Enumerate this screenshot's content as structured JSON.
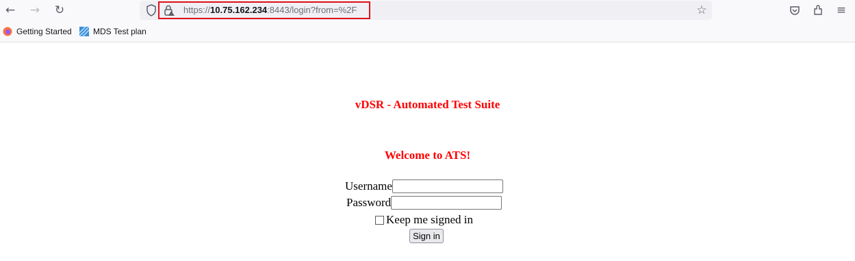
{
  "browser": {
    "url_prefix": "https://",
    "url_host": "10.75.162.234",
    "url_rest": ":8443/login?from=%2F",
    "bookmarks": [
      {
        "label": "Getting Started",
        "icon": "firefox-icon"
      },
      {
        "label": "MDS Test plan",
        "icon": "site-icon"
      }
    ]
  },
  "page": {
    "title": "vDSR - Automated Test Suite",
    "welcome": "Welcome to ATS!",
    "username_label": "Username",
    "password_label": "Password",
    "remember_label": "Keep me signed in",
    "signin_label": "Sign in"
  },
  "colors": {
    "heading": "#ff0000",
    "url_highlight": "#e0101a"
  }
}
